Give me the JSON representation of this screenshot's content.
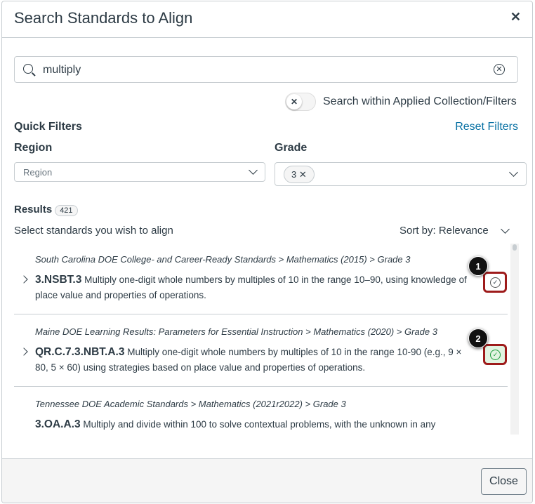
{
  "title": "Search Standards to Align",
  "search": {
    "value": "multiply"
  },
  "toggle_label": "Search within Applied Collection/Filters",
  "quick_filters": "Quick Filters",
  "reset_filters": "Reset Filters",
  "region": {
    "label": "Region",
    "placeholder": "Region"
  },
  "grade": {
    "label": "Grade",
    "selected": "3"
  },
  "results": {
    "label": "Results",
    "count": "421",
    "hint": "Select standards you wish to align",
    "sort": "Sort by: Relevance"
  },
  "items": [
    {
      "path": "South Carolina DOE College- and Career-Ready Standards > Mathematics (2015) > Grade 3",
      "code": "3.NSBT.3",
      "text": "Multiply one-digit whole numbers by multiples of 10 in the range 10–90, using knowledge of place value and properties of operations.",
      "callout": "1",
      "aligned": false
    },
    {
      "path": "Maine DOE Learning Results: Parameters for Essential Instruction > Mathematics (2020) > Grade 3",
      "code": "QR.C.7.3.NBT.A.3",
      "text": "Multiply one-digit whole numbers by multiples of 10 in the range 10-90 (e.g., 9 × 80, 5 × 60) using strategies based on place value and properties of operations.",
      "callout": "2",
      "aligned": true
    },
    {
      "path": "Tennessee DOE Academic Standards > Mathematics (2021r2022) > Grade 3",
      "code": "3.OA.A.3",
      "text": "Multiply and divide within 100 to solve contextual problems, with the unknown in any"
    }
  ],
  "close_label": "Close"
}
